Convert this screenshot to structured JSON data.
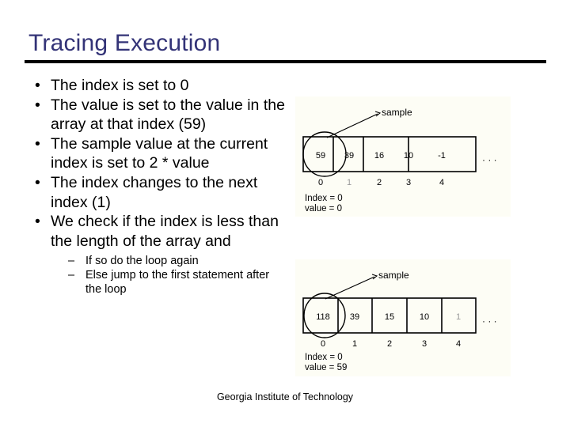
{
  "slide": {
    "title": "Tracing Execution",
    "footer": "Georgia Institute of Technology",
    "accent_color": "#333377",
    "rule_color": "#000000",
    "panel_background": "#fdfdf5",
    "body_text_color": "#000000"
  },
  "bullets": [
    {
      "marker": "•",
      "text": "The index is set to 0"
    },
    {
      "marker": "•",
      "text": "The value is set to the value in the array at that index (59)"
    },
    {
      "marker": "•",
      "text": "The sample value at the current index is set to 2 * value"
    },
    {
      "marker": "•",
      "text": "The index changes to the next index (1)"
    },
    {
      "marker": "•",
      "text": "We check if the index is less than the length of the array and"
    }
  ],
  "sub_bullets": [
    {
      "marker": "–",
      "text": "If so do the loop again"
    },
    {
      "marker": "–",
      "text": "Else jump to the first statement after the loop"
    }
  ],
  "diagrams": [
    {
      "name": "array-state-before",
      "callout_label": "sample",
      "cells": [
        "59",
        "39",
        "16",
        "10",
        "-1"
      ],
      "indices": [
        "0",
        "1",
        "2",
        "3",
        "4"
      ],
      "ellipsis": "· · ·",
      "highlighted_cell_index": 0,
      "status_lines": [
        "Index = 0",
        "value = 0"
      ]
    },
    {
      "name": "array-state-after",
      "callout_label": "sample",
      "cells": [
        "118",
        "39",
        "15",
        "10",
        "1"
      ],
      "indices": [
        "0",
        "1",
        "2",
        "3",
        "4"
      ],
      "ellipsis": "· · ·",
      "highlighted_cell_index": 0,
      "status_lines": [
        "Index = 0",
        "value = 59"
      ]
    }
  ]
}
